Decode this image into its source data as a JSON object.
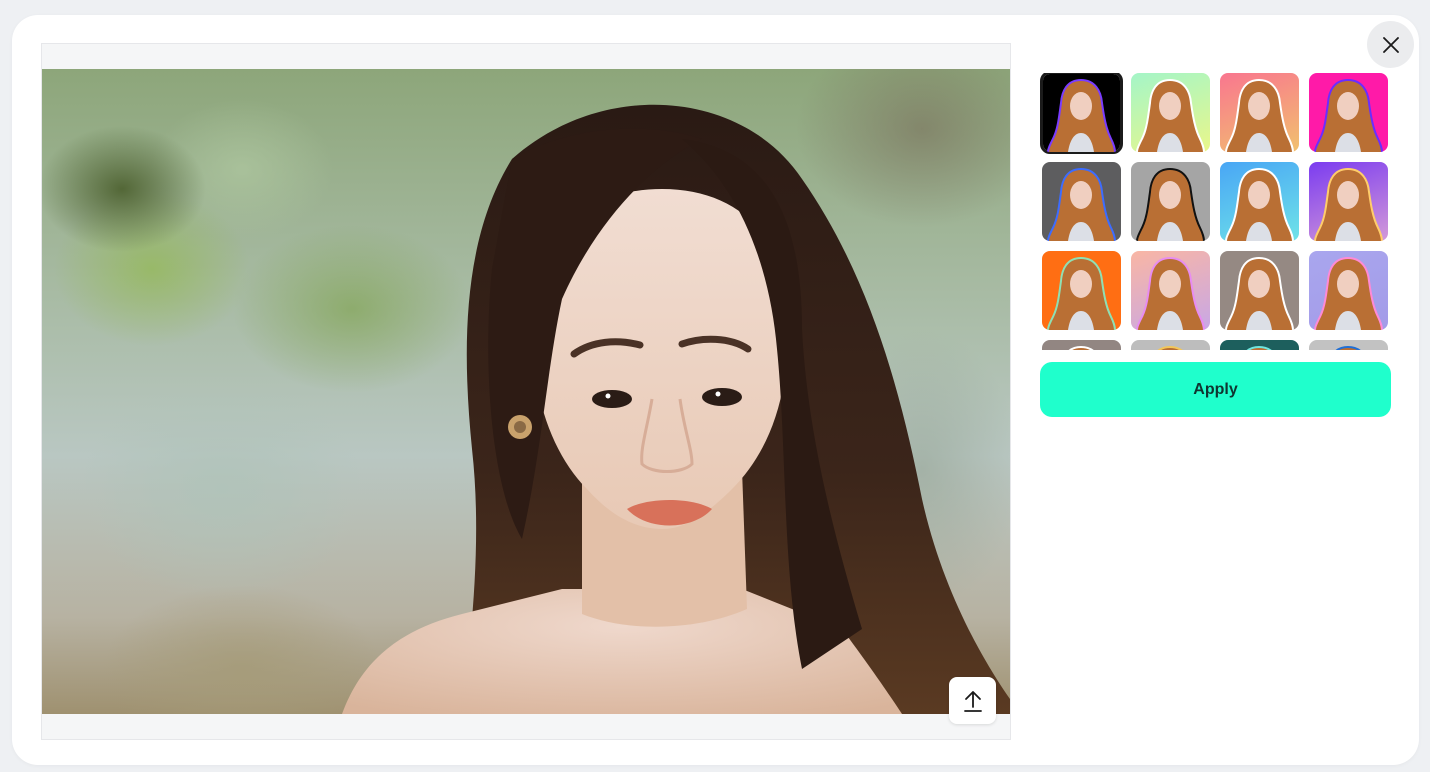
{
  "modal": {
    "close_icon": "close-icon",
    "upload_icon": "upload-icon"
  },
  "editor": {
    "image_description": "Portrait photo of a woman with long dark hair against blurred green background"
  },
  "styles": {
    "apply_label": "Apply",
    "selected_index": 0,
    "items": [
      {
        "name": "black-purple-outline",
        "bg": [
          "#000000",
          "#000000"
        ],
        "outline": "#7a3cff"
      },
      {
        "name": "mint-lime-gradient",
        "bg": [
          "#a4f5c8",
          "#e9f78a"
        ],
        "outline": "#ffffff"
      },
      {
        "name": "coral-peach-gradient",
        "bg": [
          "#f9768f",
          "#f1c16e"
        ],
        "outline": "#ffffff"
      },
      {
        "name": "magenta-purple-outline",
        "bg": [
          "#ff1aa8",
          "#ff1aa8"
        ],
        "outline": "#6a2dff"
      },
      {
        "name": "dark-gray-blue-outline",
        "bg": [
          "#5d5d5f",
          "#5d5d5f"
        ],
        "outline": "#3c6cff"
      },
      {
        "name": "gray-black-outline",
        "bg": [
          "#a5a5a5",
          "#a5a5a5"
        ],
        "outline": "#111111"
      },
      {
        "name": "sky-cyan-gradient",
        "bg": [
          "#49a6f5",
          "#6fe3e8"
        ],
        "outline": "#ffffff"
      },
      {
        "name": "violet-pink-gradient",
        "bg": [
          "#7b3cf0",
          "#d39ad8"
        ],
        "outline": "#ffcd6a"
      },
      {
        "name": "orange-mint-outline",
        "bg": [
          "#ff6e13",
          "#ff6e13"
        ],
        "outline": "#8fe0b4"
      },
      {
        "name": "peach-lavender-gradient",
        "bg": [
          "#f9b6a4",
          "#c8a7e6"
        ],
        "outline": "#e78cf1"
      },
      {
        "name": "taupe-white-outline",
        "bg": [
          "#958983",
          "#958983"
        ],
        "outline": "#ffffff"
      },
      {
        "name": "periwinkle-pink-outline",
        "bg": [
          "#a9a6ee",
          "#a39be8"
        ],
        "outline": "#ff8ad6"
      },
      {
        "name": "taupe-partial",
        "bg": [
          "#928682",
          "#928682"
        ],
        "outline": "#ffffff"
      },
      {
        "name": "silver-partial",
        "bg": [
          "#bdbdbd",
          "#bdbdbd"
        ],
        "outline": "#f2c65a"
      },
      {
        "name": "teal-partial",
        "bg": [
          "#1d5f5d",
          "#1d5f5d"
        ],
        "outline": "#6ee6de"
      },
      {
        "name": "light-gray-partial",
        "bg": [
          "#c2c2c2",
          "#c2c2c2"
        ],
        "outline": "#1f6fd6"
      }
    ]
  }
}
